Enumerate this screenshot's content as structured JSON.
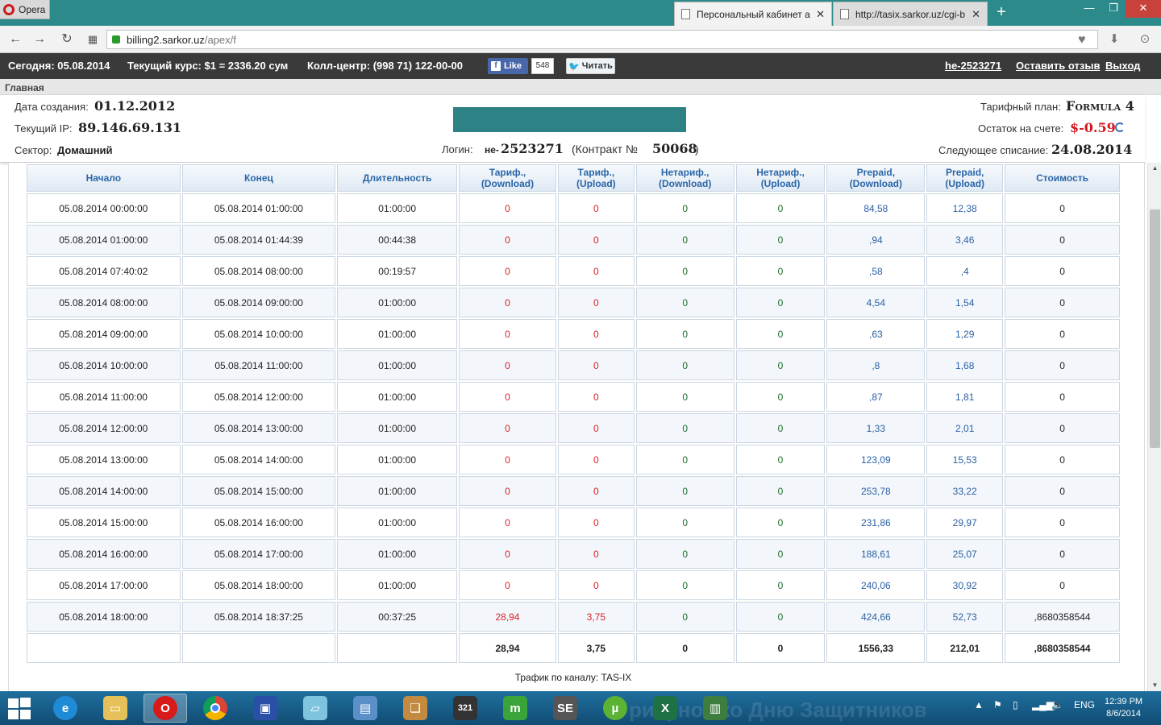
{
  "browser": {
    "menu_label": "Opera",
    "tabs": [
      {
        "title": "Персональный кабинет а",
        "active": true
      },
      {
        "title": "http://tasix.sarkor.uz/cgi-b",
        "active": false
      }
    ],
    "new_tab": "+",
    "url_host": "billing2.sarkor.uz",
    "url_path": "/apex/f"
  },
  "sitebar": {
    "today": "Сегодня: 05.08.2014",
    "rate": "Текущий курс: $1 = 2336.20 сум",
    "call_center": "Колл-центр: (998 71) 122-00-00",
    "fb_like": "Like",
    "fb_count": "548",
    "twitter": "Читать",
    "user_link": "he-2523271",
    "feedback_link": "Оставить отзыв",
    "logout_link": "Выход"
  },
  "breadcrumb": "Главная",
  "account": {
    "created_label": "Дата создания:",
    "created_value": "01.12.2012",
    "ip_label": "Текущий IP:",
    "ip_value": "89.146.69.131",
    "sector_label": "Сектор:",
    "sector_value": "Домашний",
    "login_label": "Логин:",
    "login_prefix": "не-",
    "login_value": "2523271",
    "contract_label": "(Контракт №",
    "contract_value": "50068",
    "contract_close": ")",
    "plan_label": "Тарифный план:",
    "plan_value": "Formula 4",
    "balance_label": "Остаток на счете:",
    "balance_value": "$-0.59",
    "next_charge_label": "Следующее списание:",
    "next_charge_value": "24.08.2014"
  },
  "table": {
    "headers": [
      [
        "Начало"
      ],
      [
        "Конец"
      ],
      [
        "Длительность"
      ],
      [
        "Тариф.,",
        "(Download)"
      ],
      [
        "Тариф.,",
        "(Upload)"
      ],
      [
        "Нетариф.,",
        "(Download)"
      ],
      [
        "Нетариф.,",
        "(Upload)"
      ],
      [
        "Prepaid,",
        "(Download)"
      ],
      [
        "Prepaid,",
        "(Upload)"
      ],
      [
        "Стоимость"
      ]
    ],
    "rows": [
      [
        "05.08.2014 00:00:00",
        "05.08.2014 01:00:00",
        "01:00:00",
        "0",
        "0",
        "0",
        "0",
        "84,58",
        "12,38",
        "0"
      ],
      [
        "05.08.2014 01:00:00",
        "05.08.2014 01:44:39",
        "00:44:38",
        "0",
        "0",
        "0",
        "0",
        ",94",
        "3,46",
        "0"
      ],
      [
        "05.08.2014 07:40:02",
        "05.08.2014 08:00:00",
        "00:19:57",
        "0",
        "0",
        "0",
        "0",
        ",58",
        ",4",
        "0"
      ],
      [
        "05.08.2014 08:00:00",
        "05.08.2014 09:00:00",
        "01:00:00",
        "0",
        "0",
        "0",
        "0",
        "4,54",
        "1,54",
        "0"
      ],
      [
        "05.08.2014 09:00:00",
        "05.08.2014 10:00:00",
        "01:00:00",
        "0",
        "0",
        "0",
        "0",
        ",63",
        "1,29",
        "0"
      ],
      [
        "05.08.2014 10:00:00",
        "05.08.2014 11:00:00",
        "01:00:00",
        "0",
        "0",
        "0",
        "0",
        ",8",
        "1,68",
        "0"
      ],
      [
        "05.08.2014 11:00:00",
        "05.08.2014 12:00:00",
        "01:00:00",
        "0",
        "0",
        "0",
        "0",
        ",87",
        "1,81",
        "0"
      ],
      [
        "05.08.2014 12:00:00",
        "05.08.2014 13:00:00",
        "01:00:00",
        "0",
        "0",
        "0",
        "0",
        "1,33",
        "2,01",
        "0"
      ],
      [
        "05.08.2014 13:00:00",
        "05.08.2014 14:00:00",
        "01:00:00",
        "0",
        "0",
        "0",
        "0",
        "123,09",
        "15,53",
        "0"
      ],
      [
        "05.08.2014 14:00:00",
        "05.08.2014 15:00:00",
        "01:00:00",
        "0",
        "0",
        "0",
        "0",
        "253,78",
        "33,22",
        "0"
      ],
      [
        "05.08.2014 15:00:00",
        "05.08.2014 16:00:00",
        "01:00:00",
        "0",
        "0",
        "0",
        "0",
        "231,86",
        "29,97",
        "0"
      ],
      [
        "05.08.2014 16:00:00",
        "05.08.2014 17:00:00",
        "01:00:00",
        "0",
        "0",
        "0",
        "0",
        "188,61",
        "25,07",
        "0"
      ],
      [
        "05.08.2014 17:00:00",
        "05.08.2014 18:00:00",
        "01:00:00",
        "0",
        "0",
        "0",
        "0",
        "240,06",
        "30,92",
        "0"
      ],
      [
        "05.08.2014 18:00:00",
        "05.08.2014 18:37:25",
        "00:37:25",
        "28,94",
        "3,75",
        "0",
        "0",
        "424,66",
        "52,73",
        ",8680358544"
      ]
    ],
    "totals": [
      "",
      "",
      "",
      "28,94",
      "3,75",
      "0",
      "0",
      "1556,33",
      "212,01",
      ",8680358544"
    ],
    "caption": "Трафик по каналу: TAS-IX"
  },
  "taskbar": {
    "apps": [
      "internet-explorer",
      "file-explorer",
      "opera",
      "chrome",
      "save-app",
      "notepad",
      "network-app",
      "book-app",
      "media-player-classic",
      "mtorrent",
      "se-app",
      "utorrent",
      "excel",
      "network-card-app"
    ],
    "language": "ENG",
    "time": "12:39 PM",
    "date": "8/6/2014",
    "wallpaper_text": "рисунок ко Дню Защитников"
  },
  "colors": {
    "tab_bar": "#2d8a8a",
    "banner": "#2e8286",
    "header_text": "#2b66a8",
    "red_value": "#d8232a",
    "green_value": "#1e6b2a",
    "blue_value": "#2b5fa3"
  }
}
